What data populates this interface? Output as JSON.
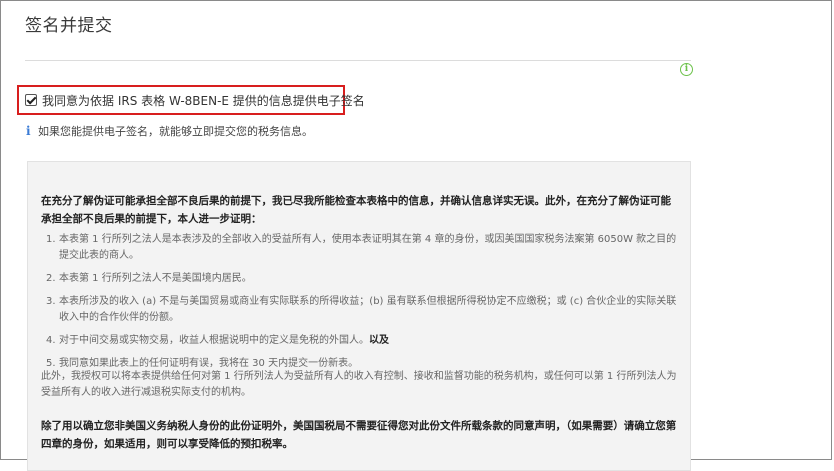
{
  "page": {
    "title": "签名并提交"
  },
  "agreement": {
    "checked": true,
    "label": "我同意为依据 IRS 表格 W-8BEN-E 提供的信息提供电子签名"
  },
  "hint": {
    "icon": "i",
    "text": "如果您能提供电子签名，就能够立即提交您的税务信息。"
  },
  "info_icon": {
    "glyph": "i",
    "color": "#6cc24a"
  },
  "highlight_color": "#d81e1e",
  "certification": {
    "intro": "在充分了解伪证可能承担全部不良后果的前提下，我已尽我所能检查本表格中的信息，并确认信息详实无误。此外，在充分了解伪证可能承担全部不良后果的前提下，本人进一步证明：",
    "items": [
      {
        "num": "1.",
        "text": "本表第 1 行所列之法人是本表涉及的全部收入的受益所有人，使用本表证明其在第 4 章的身份，或因美国国家税务法案第 6050W 款之目的提交此表的商人。",
        "bold_suffix": ""
      },
      {
        "num": "2.",
        "text": "本表第 1 行所列之法人不是美国境内居民。",
        "bold_suffix": ""
      },
      {
        "num": "3.",
        "text": "本表所涉及的收入 (a) 不是与美国贸易或商业有实际联系的所得收益；(b) 虽有联系但根据所得税协定不应缴税；或 (c) 合伙企业的实际关联收入中的合作伙伴的份额。",
        "bold_suffix": ""
      },
      {
        "num": "4.",
        "text": "对于中间交易或实物交易，收益人根据说明中的定义是免税的外国人。",
        "bold_suffix": "以及"
      },
      {
        "num": "5.",
        "text": "我同意如果此表上的任何证明有误，我将在 30 天内提交一份新表。",
        "bold_suffix": ""
      }
    ],
    "authorization": "此外，我授权可以将本表提供给任何对第 1 行所列法人为受益所有人的收入有控制、接收和监督功能的税务机构，或任何可以第 1 行所列法人为受益所有人的收入进行减退税实际支付的机构。",
    "final": "除了用以确立您非美国义务纳税人身份的此份证明外，美国国税局不需要征得您对此份文件所载条款的同意声明，（如果需要）请确立您第四章的身份，如果适用，则可以享受降低的预扣税率。"
  }
}
